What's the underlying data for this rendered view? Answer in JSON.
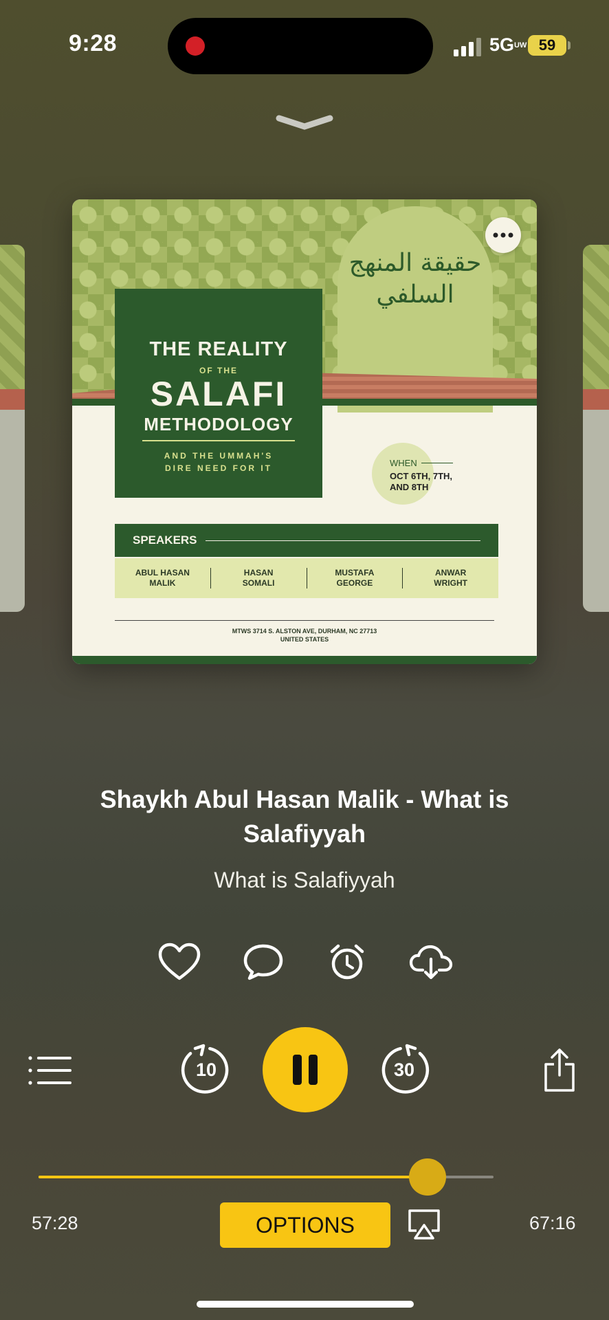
{
  "status_bar": {
    "time": "9:28",
    "network": "5G",
    "network_superscript": "UW",
    "battery": "59",
    "recording_indicator_color": "#d32027"
  },
  "artwork": {
    "arabic_title": "حقيقة المنهج السلفي",
    "title_line_1": "THE REALITY",
    "title_of_the": "OF THE",
    "title_line_2": "SALAFI",
    "title_line_3": "METHODOLOGY",
    "subtitle_line_1": "AND THE UMMAH'S",
    "subtitle_line_2": "DIRE NEED FOR IT",
    "when_label": "WHEN",
    "when_dates_1": "OCT 6TH, 7TH,",
    "when_dates_2": "AND 8TH",
    "speakers_label": "SPEAKERS",
    "speakers": [
      {
        "line1": "ABUL HASAN",
        "line2": "MALIK"
      },
      {
        "line1": "HASAN",
        "line2": "SOMALI"
      },
      {
        "line1": "MUSTAFA",
        "line2": "GEORGE"
      },
      {
        "line1": "ANWAR",
        "line2": "WRIGHT"
      }
    ],
    "address_line_1": "MTWS 3714 S. ALSTON AVE, DURHAM, NC 27713",
    "address_line_2": "UNITED STATES",
    "more_icon": "ellipsis-icon"
  },
  "episode": {
    "title": "Shaykh Abul Hasan Malik - What is Salafiyyah",
    "podcast": "What is Salafiyyah"
  },
  "actions": {
    "like_icon": "heart-icon",
    "comment_icon": "speech-bubble-icon",
    "alarm_icon": "alarm-clock-icon",
    "download_icon": "cloud-download-icon"
  },
  "playback": {
    "rewind_seconds": "10",
    "forward_seconds": "30",
    "state": "playing",
    "elapsed": "57:28",
    "total": "67:16",
    "progress_fraction": 0.855,
    "options_label": "OPTIONS",
    "accent_color": "#f8c513"
  }
}
